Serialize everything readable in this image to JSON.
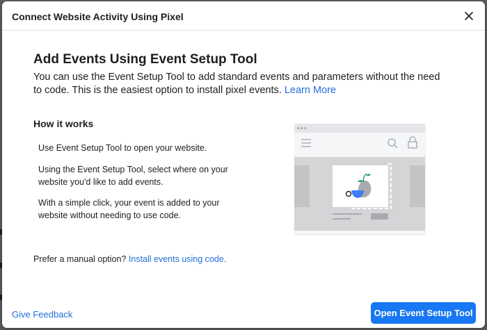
{
  "header": {
    "title": "Connect Website Activity Using Pixel"
  },
  "main": {
    "title": "Add Events Using Event Setup Tool",
    "intro_text": "You can use the Event Setup Tool to add standard events and parameters without the need to code. This is the easiest option to install pixel events. ",
    "learn_more_label": "Learn More"
  },
  "how_it_works": {
    "title": "How it works",
    "steps": [
      "Use Event Setup Tool to open your website.",
      "Using the Event Setup Tool, select where on your website you'd like to add events.",
      "With a simple click, your event is added to your website without needing to use code."
    ]
  },
  "manual": {
    "prefix": "Prefer a manual option? ",
    "link_label": "Install events using code."
  },
  "footer": {
    "feedback_label": "Give Feedback",
    "primary_button_label": "Open Event Setup Tool"
  },
  "colors": {
    "accent": "#1877f2",
    "link": "#216fdb",
    "illustration_blue": "#3d7ff5",
    "illustration_green": "#2e9d6b"
  },
  "icons": [
    "close-icon",
    "menu-icon",
    "search-icon",
    "lock-icon"
  ]
}
